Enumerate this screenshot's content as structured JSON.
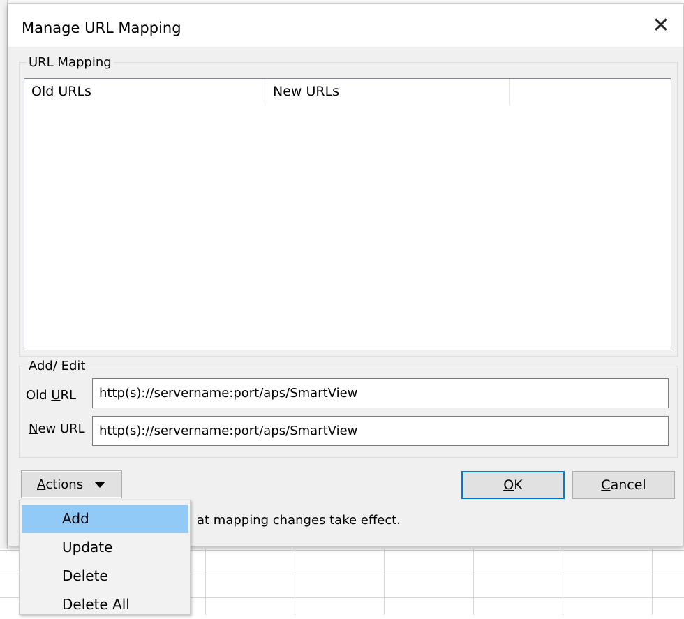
{
  "dialog": {
    "title": "Manage URL Mapping",
    "close_glyph": "✕"
  },
  "mapping_group": {
    "legend": "URL Mapping",
    "columns": [
      "Old URLs",
      "New URLs"
    ],
    "rows": []
  },
  "edit_group": {
    "legend": "Add/ Edit",
    "old_url_label_prefix": "Old ",
    "old_url_label_mnemonic": "U",
    "old_url_label_suffix": "RL",
    "old_url_value": "http(s)://servername:port/aps/SmartView",
    "new_url_label_mnemonic": "N",
    "new_url_label_suffix": "ew URL",
    "new_url_value": "http(s)://servername:port/aps/SmartView"
  },
  "buttons": {
    "actions_mnemonic": "A",
    "actions_rest": "ctions",
    "ok_mnemonic": "O",
    "ok_rest": "K",
    "cancel_mnemonic": "C",
    "cancel_rest": "ancel"
  },
  "note_text": "at mapping changes take effect.",
  "actions_menu": {
    "items": [
      "Add",
      "Update",
      "Delete",
      "Delete All"
    ],
    "highlighted": "Add"
  },
  "icons": {
    "close": "close-icon",
    "dropdown": "caret-down-icon"
  },
  "colors": {
    "dialog_bg": "#f0f0f0",
    "focus_border": "#0078d7",
    "menu_highlight": "#91c9f7"
  }
}
